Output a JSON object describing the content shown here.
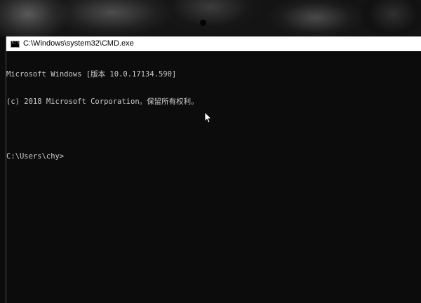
{
  "window": {
    "title": "C:\\Windows\\system32\\CMD.exe",
    "icon": "cmd-icon"
  },
  "console": {
    "lines": [
      "Microsoft Windows [版本 10.0.17134.590]",
      "(c) 2018 Microsoft Corporation。保留所有权利。",
      "",
      "C:\\Users\\chy>"
    ]
  },
  "colors": {
    "console_bg": "#0c0c0c",
    "console_text": "#cccccc",
    "titlebar_bg": "#ffffff"
  }
}
